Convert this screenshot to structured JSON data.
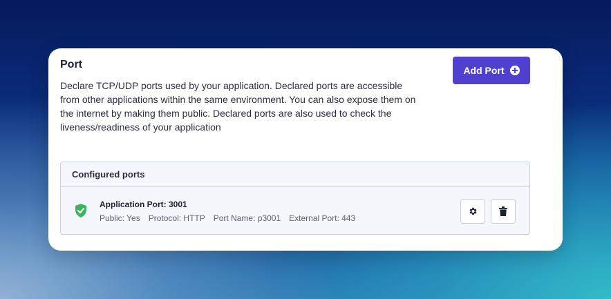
{
  "section": {
    "title": "Port",
    "description": "Declare TCP/UDP ports used by your application. Declared ports are accessible from other applications within the same environment. You can also expose them on the internet by making them public. Declared ports are also used to check the liveness/readiness of your application",
    "add_button_label": "Add Port",
    "add_button_icon": "plus-circle-icon"
  },
  "configured_ports": {
    "header": "Configured ports",
    "items": [
      {
        "title": "Application Port: 3001",
        "public": "Public: Yes",
        "protocol": "Protocol: HTTP",
        "port_name": "Port Name: p3001",
        "external_port": "External Port: 443",
        "status_icon": "shield-check-icon",
        "status_color": "#3bb55e"
      }
    ]
  },
  "colors": {
    "accent": "#5040cf"
  }
}
